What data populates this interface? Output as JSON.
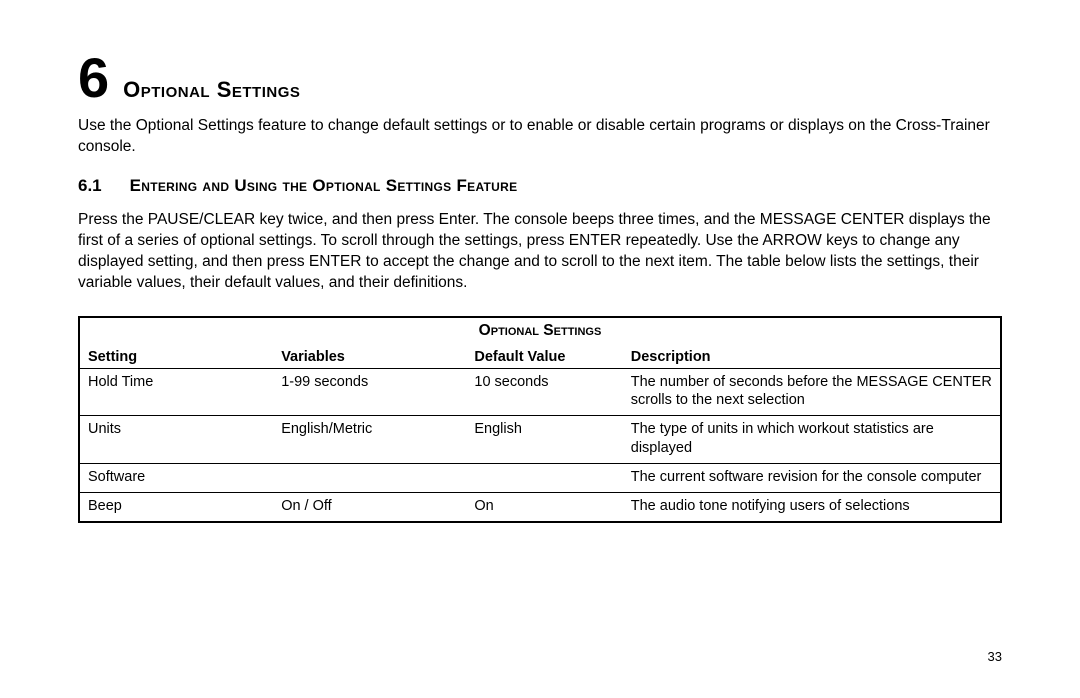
{
  "chapter": {
    "number": "6",
    "title": "Optional Settings"
  },
  "intro": "Use the Optional Settings feature to change default settings or to enable or disable certain programs or displays on the Cross-Trainer console.",
  "section": {
    "number": "6.1",
    "title": "Entering and Using the Optional Settings Feature",
    "body": "Press the PAUSE/CLEAR key twice, and then press Enter. The console beeps three times, and the MESSAGE CENTER displays the first of a series of optional settings. To scroll through the settings, press ENTER repeatedly. Use the ARROW keys to change any displayed setting, and then press ENTER to accept the change and to scroll to the next item. The table below lists the settings, their variable values, their default values, and their definitions."
  },
  "table": {
    "title": "Optional Settings",
    "headers": {
      "setting": "Setting",
      "variables": "Variables",
      "default": "Default Value",
      "description": "Description"
    },
    "rows": [
      {
        "setting": "Hold Time",
        "variables": "1-99 seconds",
        "default": "10 seconds",
        "description": "The number of seconds before the MESSAGE CENTER scrolls to the next selection"
      },
      {
        "setting": "Units",
        "variables": "English/Metric",
        "default": "English",
        "description": "The type of units in which workout statistics are displayed"
      },
      {
        "setting": "Software",
        "variables": "",
        "default": "",
        "description": "The current software revision for the console computer"
      },
      {
        "setting": "Beep",
        "variables": "On / Off",
        "default": "On",
        "description": "The audio tone notifying users of selections"
      }
    ]
  },
  "page_number": "33"
}
